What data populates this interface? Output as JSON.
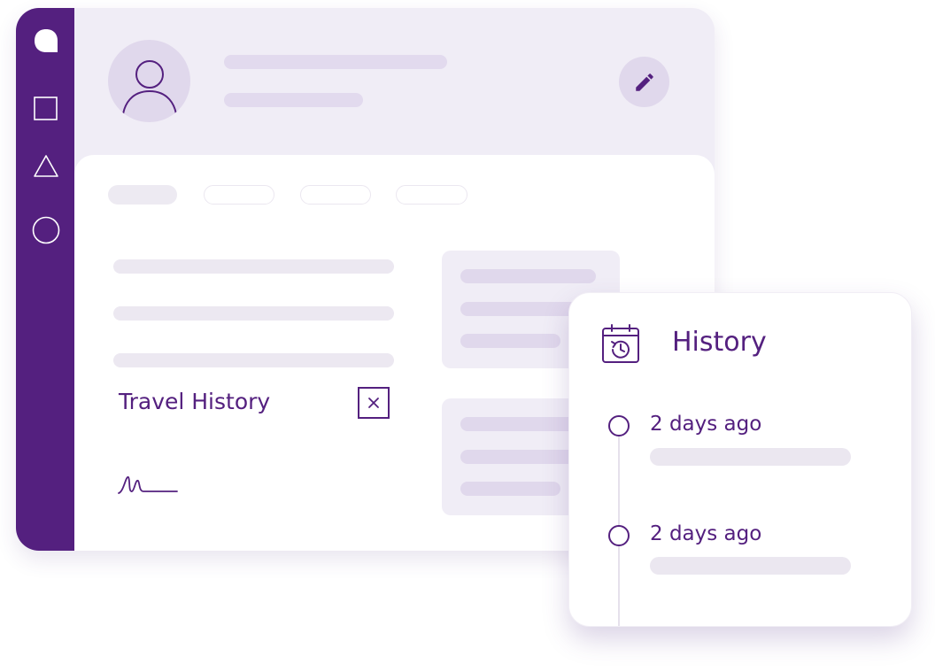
{
  "colors": {
    "brand": "#54207f",
    "sidebar": "#54207f",
    "window_bg": "#f0edf6",
    "placeholder_bar": "#e2daee",
    "card_bg": "#ffffff"
  },
  "sidebar": {
    "items": [
      {
        "icon": "blob-icon"
      },
      {
        "icon": "square-icon"
      },
      {
        "icon": "triangle-icon"
      },
      {
        "icon": "circle-icon"
      }
    ]
  },
  "header": {
    "avatar_icon": "user-icon",
    "edit_icon": "pencil-icon"
  },
  "main": {
    "field_label": "Travel History",
    "close_icon": "close-icon",
    "signature_icon": "signature-icon"
  },
  "history": {
    "icon": "calendar-history-icon",
    "title": "History",
    "entries": [
      {
        "label": "2 days ago"
      },
      {
        "label": "2 days ago"
      }
    ]
  }
}
